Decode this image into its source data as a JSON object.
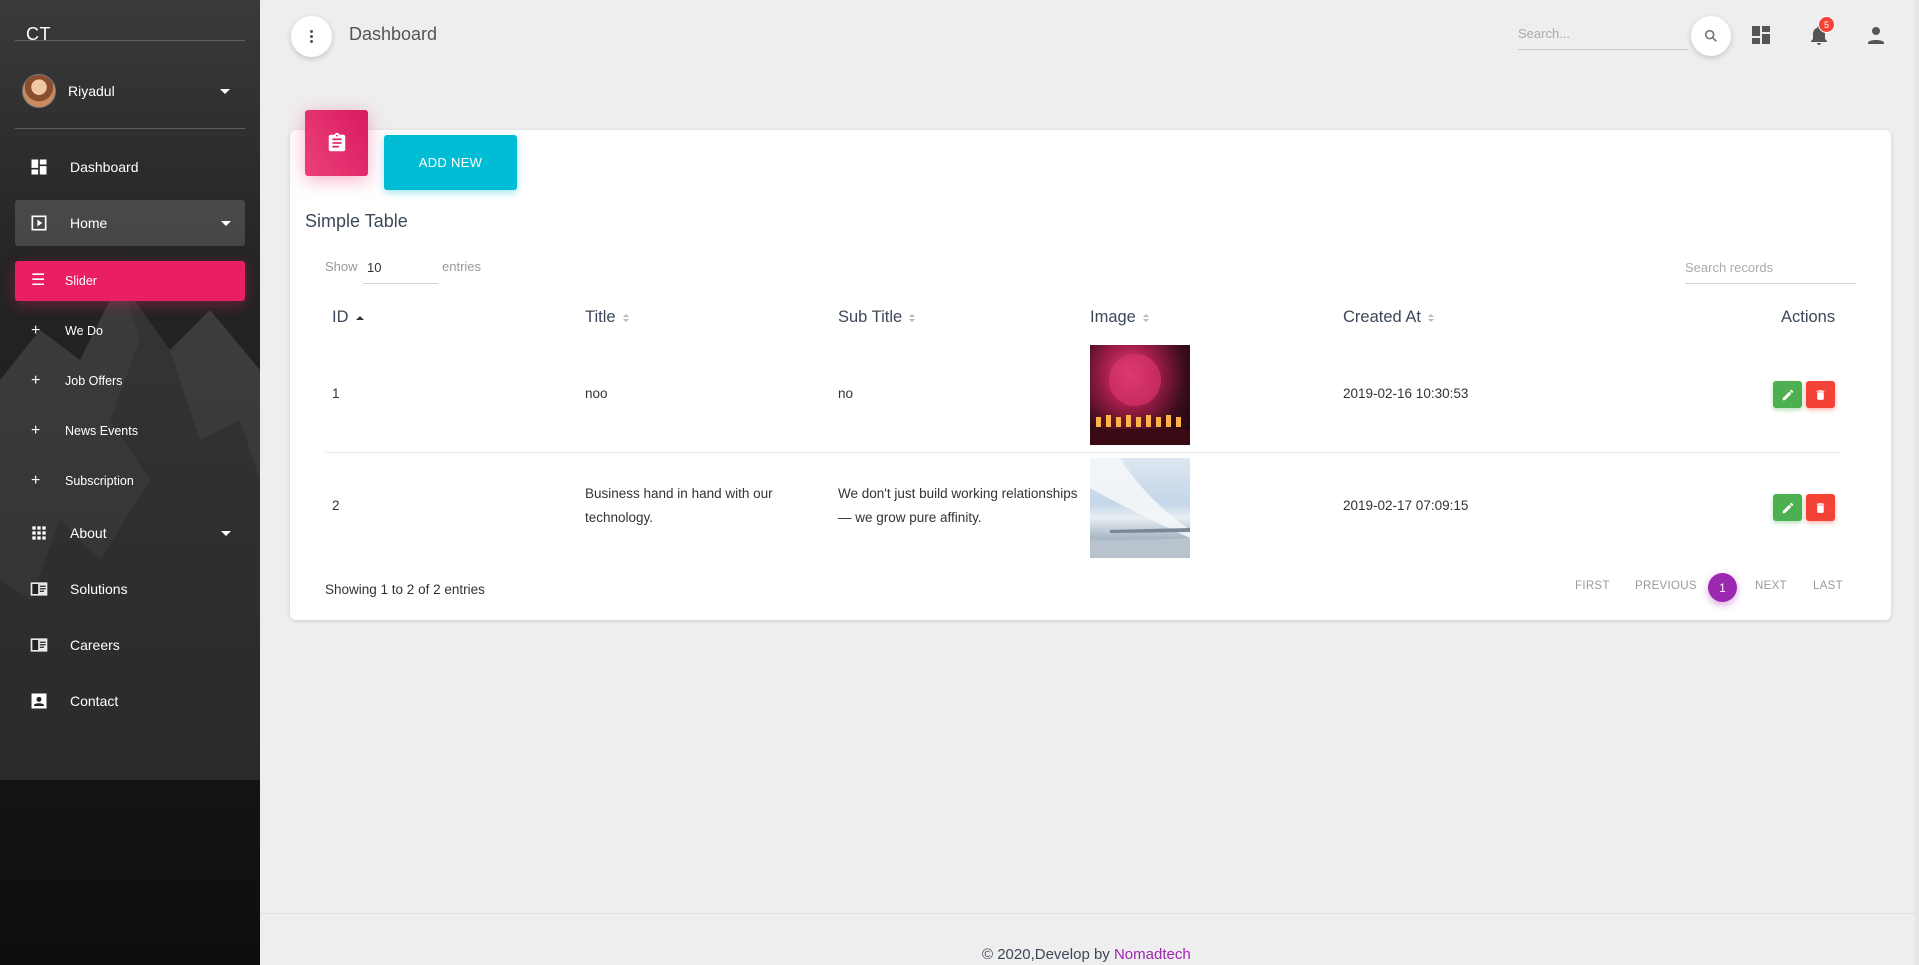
{
  "sidebar": {
    "brand": "CT",
    "user": {
      "name": "Riyadul"
    },
    "items": [
      {
        "label": "Dashboard",
        "icon": "dashboard-icon"
      },
      {
        "label": "Home",
        "icon": "play-box-icon",
        "expanded": true
      },
      {
        "label": "Slider",
        "icon": "list-icon",
        "active": true
      },
      {
        "label": "We Do",
        "icon": "plus-icon"
      },
      {
        "label": "Job Offers",
        "icon": "plus-icon"
      },
      {
        "label": "News Events",
        "icon": "plus-icon"
      },
      {
        "label": "Subscription",
        "icon": "plus-icon"
      },
      {
        "label": "About",
        "icon": "apps-grid-icon"
      },
      {
        "label": "Solutions",
        "icon": "chrome-reader-icon"
      },
      {
        "label": "Careers",
        "icon": "chrome-reader-icon"
      },
      {
        "label": "Contact",
        "icon": "contact-card-icon"
      }
    ]
  },
  "header": {
    "title": "Dashboard",
    "search_placeholder": "Search...",
    "notifications_count": "5"
  },
  "card": {
    "add_label": "ADD NEW",
    "title": "Simple Table",
    "show_label": "Show",
    "entries_value": "10",
    "entries_label": "entries",
    "search_placeholder": "Search records",
    "columns": [
      "ID",
      "Title",
      "Sub Title",
      "Image",
      "Created At",
      "Actions"
    ],
    "rows": [
      {
        "id": "1",
        "title": "noo",
        "subtitle": "no",
        "created_at": "2019-02-16 10:30:53"
      },
      {
        "id": "2",
        "title": "Business hand in hand with our technology.",
        "subtitle": "We don't just build working relationships — we grow pure affinity.",
        "created_at": "2019-02-17 07:09:15"
      }
    ],
    "showing": "Showing 1 to 2 of 2 entries",
    "pagination": {
      "first": "FIRST",
      "previous": "PREVIOUS",
      "current": "1",
      "next": "NEXT",
      "last": "LAST"
    }
  },
  "footer": {
    "text": "© 2020,Develop by ",
    "link": "Nomadtech"
  },
  "colors": {
    "accent": "#e91e63",
    "info": "#00bcd4",
    "success": "#4caf50",
    "danger": "#f44336",
    "primary": "#9c27b0"
  }
}
